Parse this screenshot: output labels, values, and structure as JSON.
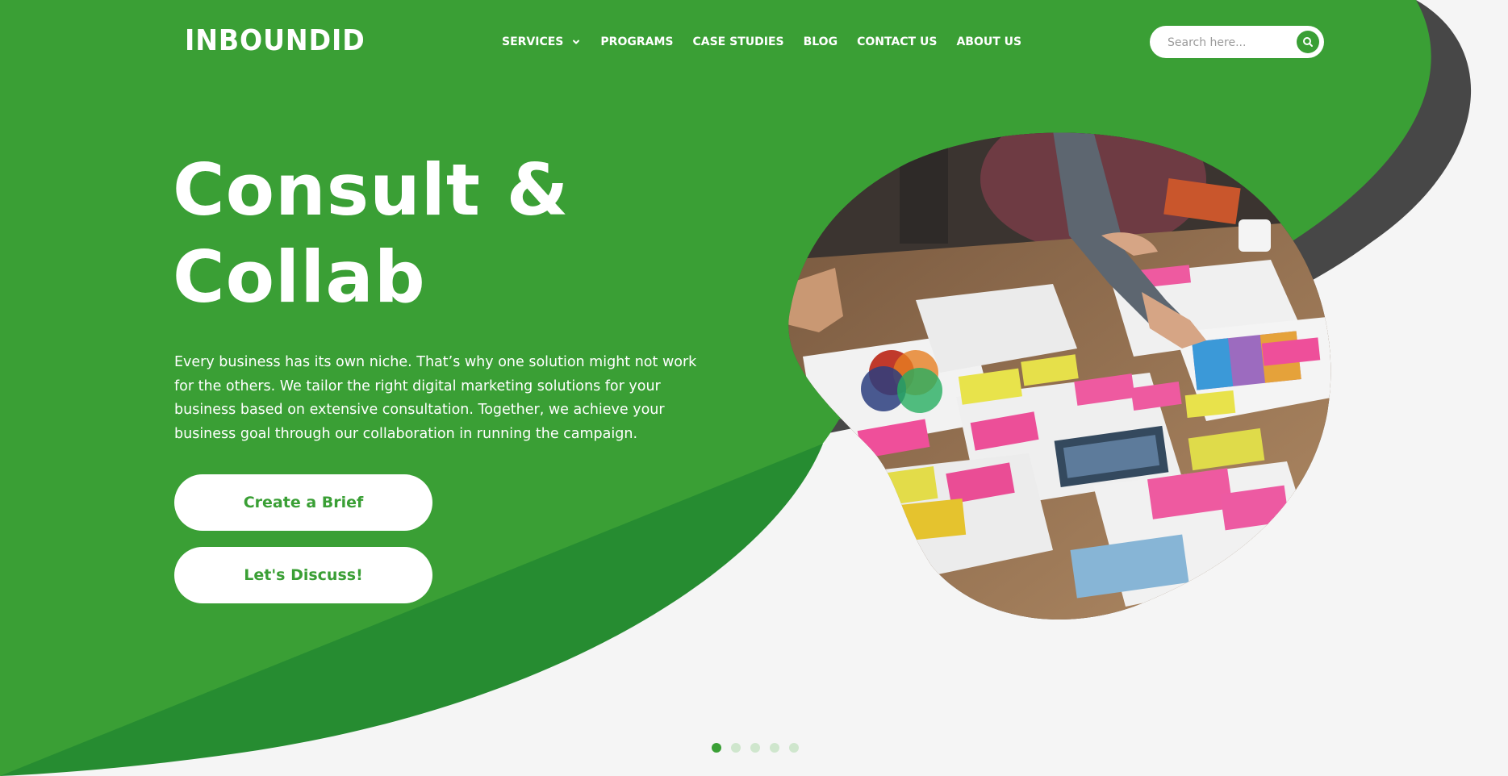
{
  "colors": {
    "brand_green": "#3a9f35",
    "dark_green": "#268c31",
    "dark_gray": "#474747",
    "background": "#f5f5f5",
    "white": "#ffffff"
  },
  "header": {
    "logo": "INBOUNDID",
    "nav": [
      {
        "label": "SERVICES",
        "has_dropdown": true,
        "icon": "chevron-down-icon"
      },
      {
        "label": "PROGRAMS",
        "has_dropdown": false
      },
      {
        "label": "CASE STUDIES",
        "has_dropdown": false
      },
      {
        "label": "BLOG",
        "has_dropdown": false
      },
      {
        "label": "CONTACT US",
        "has_dropdown": false
      },
      {
        "label": "ABOUT US",
        "has_dropdown": false
      }
    ],
    "search": {
      "placeholder": "Search here...",
      "icon": "search-icon"
    }
  },
  "hero": {
    "title_line1": "Consult &",
    "title_line2": "Collab",
    "description": "Every business has its own niche. That’s why one solution might not work for the others. We tailor the right digital marketing solutions for your business based on extensive consultation. Together, we achieve your business goal through our collaboration in running the campaign.",
    "buttons": {
      "brief": "Create a Brief",
      "discuss": "Let's Discuss!"
    },
    "image": "team-collaboration-photo"
  },
  "slider": {
    "total": 5,
    "active": 1
  }
}
